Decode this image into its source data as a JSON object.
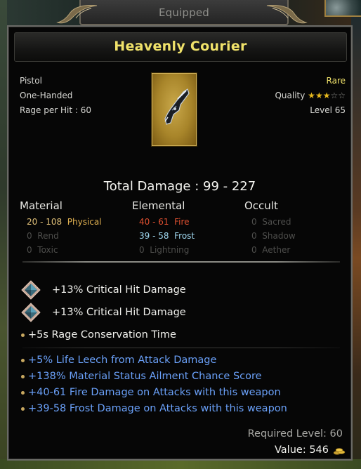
{
  "header": {
    "equipped_label": "Equipped"
  },
  "item": {
    "name": "Heavenly Courier",
    "type": "Pistol",
    "handedness": "One-Handed",
    "rage_per_hit": "Rage per Hit : 60",
    "rarity": "Rare",
    "quality_label": "Quality",
    "quality_stars": 3,
    "quality_max": 5,
    "level": "Level 65",
    "art_icon": "pistol-icon"
  },
  "damage": {
    "total": "Total Damage : 99 - 227",
    "columns": {
      "material": {
        "header": "Material",
        "rows": [
          {
            "value": "20 - 108",
            "type": "Physical"
          },
          {
            "value": "0",
            "type": "Rend"
          },
          {
            "value": "0",
            "type": "Toxic"
          }
        ]
      },
      "elemental": {
        "header": "Elemental",
        "rows": [
          {
            "value": "40 - 61",
            "type": "Fire"
          },
          {
            "value": "39 - 58",
            "type": "Frost"
          },
          {
            "value": "0",
            "type": "Lightning"
          }
        ]
      },
      "occult": {
        "header": "Occult",
        "rows": [
          {
            "value": "0",
            "type": "Sacred"
          },
          {
            "value": "0",
            "type": "Shadow"
          },
          {
            "value": "0",
            "type": "Aether"
          }
        ]
      }
    }
  },
  "affixes": {
    "gem": [
      {
        "text": "+13% Critical Hit Damage",
        "icon": "gem-icon"
      },
      {
        "text": "+13% Critical Hit Damage",
        "icon": "gem-icon"
      }
    ],
    "implicit": [
      "+5s Rage Conservation Time"
    ],
    "magic": [
      "+5% Life Leech from Attack Damage",
      "+138% Material Status Ailment Chance Score",
      "+40-61 Fire Damage on Attacks with this weapon",
      "+39-58 Frost Damage on Attacks with this weapon"
    ]
  },
  "footer": {
    "required_level": "Required Level: 60",
    "value": "Value: 546",
    "coin_icon": "gold-coins-icon"
  },
  "colors": {
    "title": "#f0e26a",
    "rare": "#f0e26a",
    "magic_affix": "#6aa0f8",
    "fire": "#e05030",
    "frost": "#a0d8f0",
    "physical": "#e0b050",
    "star": "#e6b81e"
  }
}
